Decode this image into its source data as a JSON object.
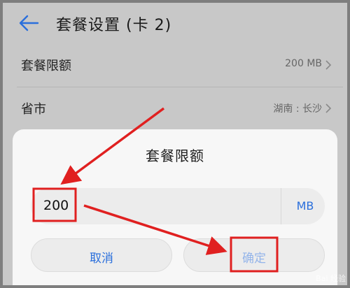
{
  "appbar": {
    "title": "套餐设置 (卡 2)",
    "back_icon": "arrow-left-icon"
  },
  "rows": [
    {
      "label": "套餐限额",
      "value": "200 MB"
    },
    {
      "label": "省市",
      "value": "湖南 : 长沙"
    }
  ],
  "dialog": {
    "title": "套餐限额",
    "input_value": "200",
    "unit": "MB",
    "cancel_label": "取消",
    "confirm_label": "确定"
  },
  "watermark": "Bai 经验",
  "colors": {
    "accent": "#2a6fdc",
    "annotation": "#e02020"
  }
}
